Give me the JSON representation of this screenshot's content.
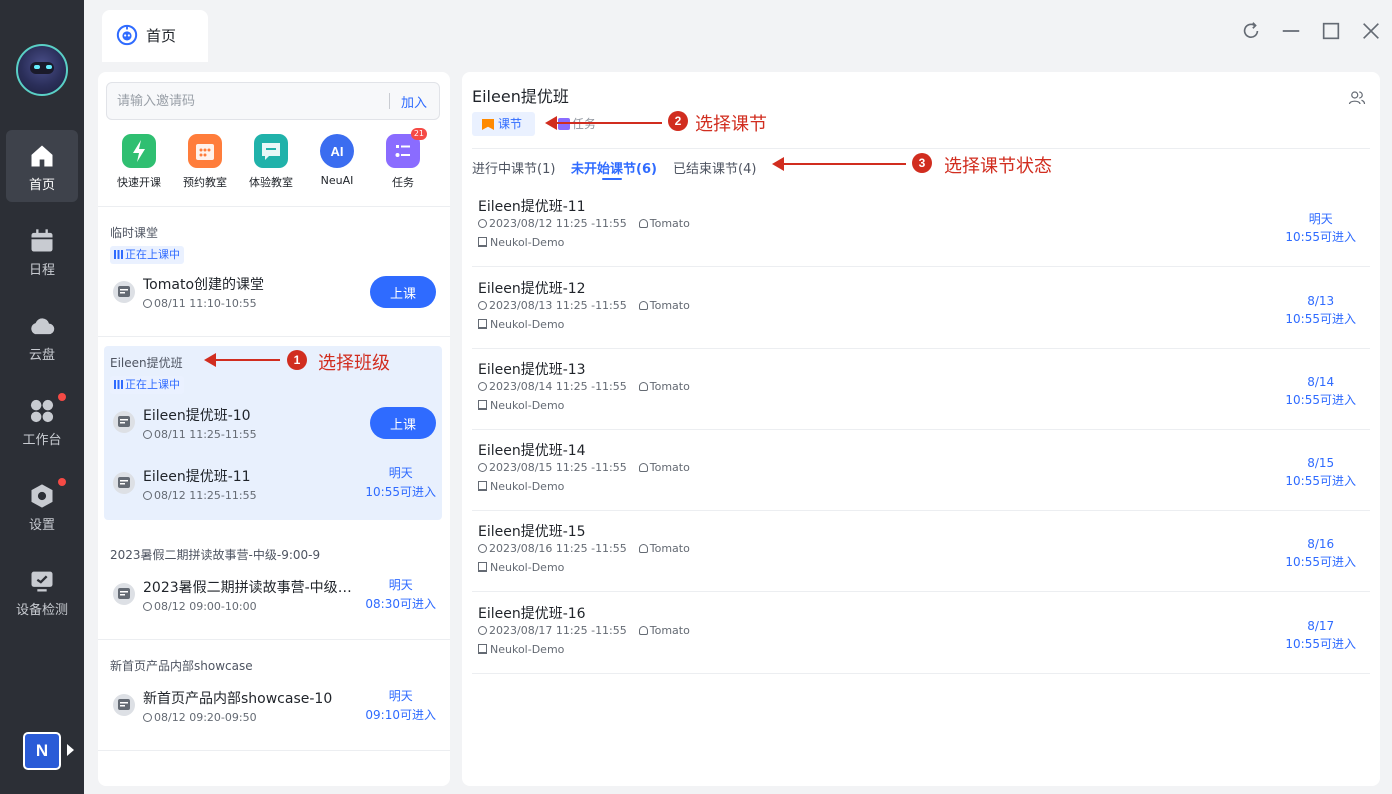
{
  "sidebar": {
    "items": [
      {
        "label": "首页",
        "icon": "home-icon",
        "active": true
      },
      {
        "label": "日程",
        "icon": "calendar-icon"
      },
      {
        "label": "云盘",
        "icon": "cloud-icon"
      },
      {
        "label": "工作台",
        "icon": "workbench-icon",
        "dot": true
      },
      {
        "label": "设置",
        "icon": "settings-icon",
        "dot": true
      },
      {
        "label": "设备检测",
        "icon": "device-check-icon"
      }
    ],
    "badge_letter": "N"
  },
  "header": {
    "tab_title": "首页"
  },
  "invite": {
    "placeholder": "请输入邀请码",
    "join_label": "加入"
  },
  "quick_actions": [
    {
      "label": "快速开课",
      "icon": "lightning-icon",
      "color": "#2fbf71"
    },
    {
      "label": "预约教室",
      "icon": "calendar-grid-icon",
      "color": "#ff7d3b"
    },
    {
      "label": "体验教室",
      "icon": "chat-icon",
      "color": "#20b2aa"
    },
    {
      "label": "NeuAI",
      "icon": "ai-icon",
      "color": "#3b6df0"
    },
    {
      "label": "任务",
      "icon": "task-icon",
      "color": "#8a6cff",
      "badge": "21"
    }
  ],
  "class_groups": [
    {
      "title": "临时课堂",
      "live_tag": "正在上课中",
      "lessons": [
        {
          "name": "Tomato创建的课堂",
          "time": "08/11 11:10-10:55",
          "action": "上课"
        }
      ]
    },
    {
      "title": "Eileen提优班",
      "live_tag": "正在上课中",
      "lessons": [
        {
          "name": "Eileen提优班-10",
          "time": "08/11 11:25-11:55",
          "action": "上课"
        },
        {
          "name": "Eileen提优班-11",
          "time": "08/12 11:25-11:55",
          "enter_day": "明天",
          "enter_time": "10:55可进入"
        }
      ]
    },
    {
      "title": "2023暑假二期拼读故事营-中级-9:00-9",
      "lessons": [
        {
          "name": "2023暑假二期拼读故事营-中级-9:00-9",
          "time": "08/12 09:00-10:00",
          "enter_day": "明天",
          "enter_time": "08:30可进入"
        }
      ]
    },
    {
      "title": "新首页产品内部showcase",
      "lessons": [
        {
          "name": "新首页产品内部showcase-10",
          "time": "08/12 09:20-09:50",
          "enter_day": "明天",
          "enter_time": "09:10可进入"
        }
      ]
    }
  ],
  "detail": {
    "class_title": "Eileen提优班",
    "tabs": {
      "lesson": "课节",
      "task": "任务"
    },
    "state_tabs": [
      "进行中课节(1)",
      "未开始课节(6)",
      "已结束课节(4)"
    ],
    "lessons": [
      {
        "name": "Eileen提优班-11",
        "time": "2023/08/12 11:25 -11:55",
        "teacher": "Tomato",
        "location": "Neukol-Demo",
        "enter_day": "明天",
        "enter_time": "10:55可进入"
      },
      {
        "name": "Eileen提优班-12",
        "time": "2023/08/13 11:25 -11:55",
        "teacher": "Tomato",
        "location": "Neukol-Demo",
        "enter_day": "8/13",
        "enter_time": "10:55可进入"
      },
      {
        "name": "Eileen提优班-13",
        "time": "2023/08/14 11:25 -11:55",
        "teacher": "Tomato",
        "location": "Neukol-Demo",
        "enter_day": "8/14",
        "enter_time": "10:55可进入"
      },
      {
        "name": "Eileen提优班-14",
        "time": "2023/08/15 11:25 -11:55",
        "teacher": "Tomato",
        "location": "Neukol-Demo",
        "enter_day": "8/15",
        "enter_time": "10:55可进入"
      },
      {
        "name": "Eileen提优班-15",
        "time": "2023/08/16 11:25 -11:55",
        "teacher": "Tomato",
        "location": "Neukol-Demo",
        "enter_day": "8/16",
        "enter_time": "10:55可进入"
      },
      {
        "name": "Eileen提优班-16",
        "time": "2023/08/17 11:25 -11:55",
        "teacher": "Tomato",
        "location": "Neukol-Demo",
        "enter_day": "8/17",
        "enter_time": "10:55可进入"
      }
    ]
  },
  "annotations": [
    {
      "num": "1",
      "text": "选择班级"
    },
    {
      "num": "2",
      "text": "选择课节"
    },
    {
      "num": "3",
      "text": "选择课节状态"
    }
  ],
  "colors": {
    "accent": "#2f6bff",
    "sidebar": "#2c2f36",
    "annotation": "#d12d1f",
    "highlight": "#e8f0fd"
  }
}
